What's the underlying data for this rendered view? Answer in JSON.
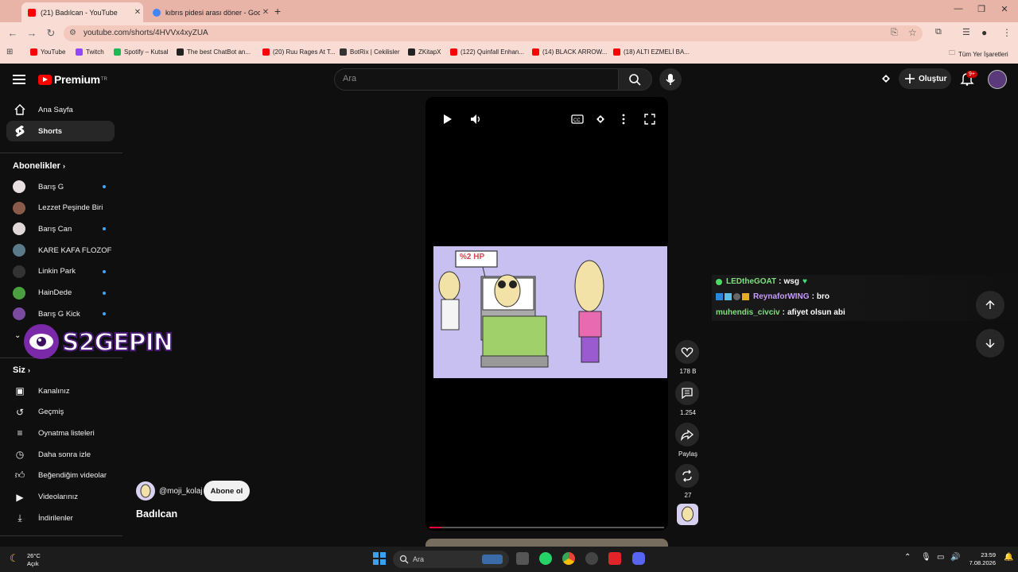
{
  "browser": {
    "tabs": [
      {
        "title": "(21) Badılcan - YouTube",
        "active": true
      },
      {
        "title": "kıbrıs pidesi arası döner - Goog",
        "active": false
      }
    ],
    "url": "youtube.com/shorts/4HVVx4xyZUA",
    "bookmarks": [
      {
        "label": "YouTube",
        "color": "#ff0000"
      },
      {
        "label": "Twitch",
        "color": "#9146ff"
      },
      {
        "label": "Spotify – Kutsal",
        "color": "#1db954"
      },
      {
        "label": "The best ChatBot an...",
        "color": "#222222"
      },
      {
        "label": "(20) Ruu Rages At T...",
        "color": "#ff0000"
      },
      {
        "label": "BotRix | Cekilisler",
        "color": "#333333"
      },
      {
        "label": "ZKitapX",
        "color": "#222222"
      },
      {
        "label": "(122) Quinfall Enhan...",
        "color": "#ff0000"
      },
      {
        "label": "(14) BLACK ARROW...",
        "color": "#ff0000"
      },
      {
        "label": "(18) ALTI EZMELİ BA...",
        "color": "#ff0000"
      }
    ],
    "all_bookmarks": "Tüm Yer İşaretleri"
  },
  "youtube": {
    "logo": {
      "text": "Premium",
      "region": "TR"
    },
    "search": {
      "placeholder": "Ara"
    },
    "create_label": "Oluştur",
    "notif_count": "9+",
    "sidebar": {
      "main": [
        {
          "label": "Ana Sayfa",
          "icon": "home-icon"
        },
        {
          "label": "Shorts",
          "icon": "shorts-icon",
          "selected": true
        }
      ],
      "subs_title": "Abonelikler",
      "subs": [
        {
          "label": "Barış G",
          "color": "#e8e0e0",
          "dot": true
        },
        {
          "label": "Lezzet Peşinde Biri",
          "color": "#8a5a4a",
          "dot": false
        },
        {
          "label": "Barış Can",
          "color": "#e0d8d8",
          "dot": true
        },
        {
          "label": "KARE KAFA FLOZOF",
          "color": "#5a7a8a",
          "dot": false
        },
        {
          "label": "Linkin Park",
          "color": "#333333",
          "dot": true
        },
        {
          "label": "HainDede",
          "color": "#4aa040",
          "dot": true
        },
        {
          "label": "Barış G Kick",
          "color": "#7a4aa0",
          "dot": true
        }
      ],
      "you_title": "Siz",
      "you": [
        {
          "label": "Kanalınız",
          "icon": "channel-icon"
        },
        {
          "label": "Geçmiş",
          "icon": "history-icon"
        },
        {
          "label": "Oynatma listeleri",
          "icon": "playlist-icon"
        },
        {
          "label": "Daha sonra izle",
          "icon": "clock-icon"
        },
        {
          "label": "Beğendiğim videolar",
          "icon": "thumbs-up-icon"
        },
        {
          "label": "Videolarınız",
          "icon": "videos-icon"
        },
        {
          "label": "İndirilenler",
          "icon": "download-icon"
        }
      ]
    },
    "short": {
      "art_label": "%2 HP",
      "channel": "@moji_kolaj",
      "subscribe_label": "Abone ol",
      "title": "Badılcan",
      "progress": 0.05,
      "actions": {
        "likes": "178 B",
        "comments": "1.254",
        "share": "Paylaş",
        "remix": "27"
      }
    },
    "chat": [
      {
        "user": "LEDtheGOAT",
        "message": "wsg",
        "color": "#7fe07f"
      },
      {
        "user": "ReynaforWING",
        "message": "bro",
        "color": "#c79bff"
      },
      {
        "user": "muhendis_civciv",
        "message": "afiyet olsun abi",
        "color": "#7fe07f"
      }
    ],
    "watermark": "S2GEPIN"
  },
  "taskbar": {
    "weather_temp": "26°C",
    "weather_desc": "Açık",
    "search_label": "Ara",
    "time": "23:59",
    "date": "7.08.2026"
  }
}
